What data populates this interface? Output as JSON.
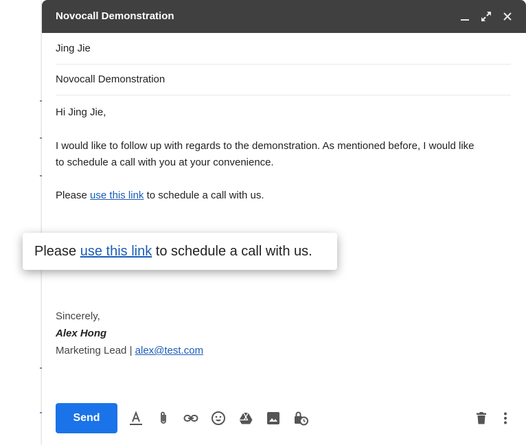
{
  "window": {
    "title": "Novocall Demonstration"
  },
  "fields": {
    "to": "Jing Jie",
    "subject": "Novocall Demonstration"
  },
  "body": {
    "greeting": "Hi Jing Jie,",
    "paragraph_line1": "I would like to follow up with regards to the demonstration. As mentioned before, I would like",
    "paragraph_line2": "to schedule a call with you at your convenience.",
    "cta_prefix": "Please ",
    "cta_link": "use this link",
    "cta_suffix": " to schedule a call with us."
  },
  "callout": {
    "prefix": "Please ",
    "link": "use this link",
    "suffix": " to schedule a call with us."
  },
  "signature": {
    "closing": "Sincerely,",
    "name": "Alex Hong",
    "role": "Marketing Lead | ",
    "email": "alex@test.com"
  },
  "toolbar": {
    "send_label": "Send",
    "icons": [
      "format-text-icon",
      "attach-icon",
      "link-icon",
      "emoji-icon",
      "drive-icon",
      "photo-icon",
      "confidential-icon",
      "trash-icon",
      "more-options-icon"
    ]
  },
  "colors": {
    "titlebar": "#404040",
    "send_button": "#1a73e8",
    "link": "#1a5cb8"
  }
}
